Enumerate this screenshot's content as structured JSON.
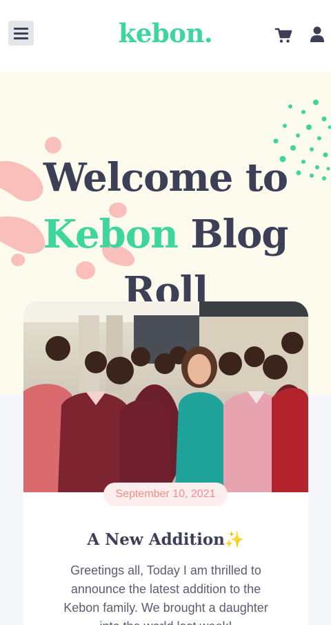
{
  "header": {
    "logo": "kebon.",
    "menu_icon": "hamburger-menu-icon",
    "cart_icon": "shopping-cart-icon",
    "user_icon": "user-account-icon"
  },
  "hero": {
    "title_line1": "Welcome to",
    "title_accent": "Kebon",
    "title_rest": " Blog Roll"
  },
  "post": {
    "date": "September 10, 2021",
    "title": "A New Addition",
    "title_emoji": "✨",
    "excerpt": "Greetings all, Today I am thrilled to announce the latest addition to the Kebon family. We brought a daughter into the world last week!"
  },
  "colors": {
    "brand_green": "#3fd69d",
    "dark_navy": "#3c3f56",
    "coral": "#f8a9a9",
    "hero_bg": "#fdfbed"
  }
}
